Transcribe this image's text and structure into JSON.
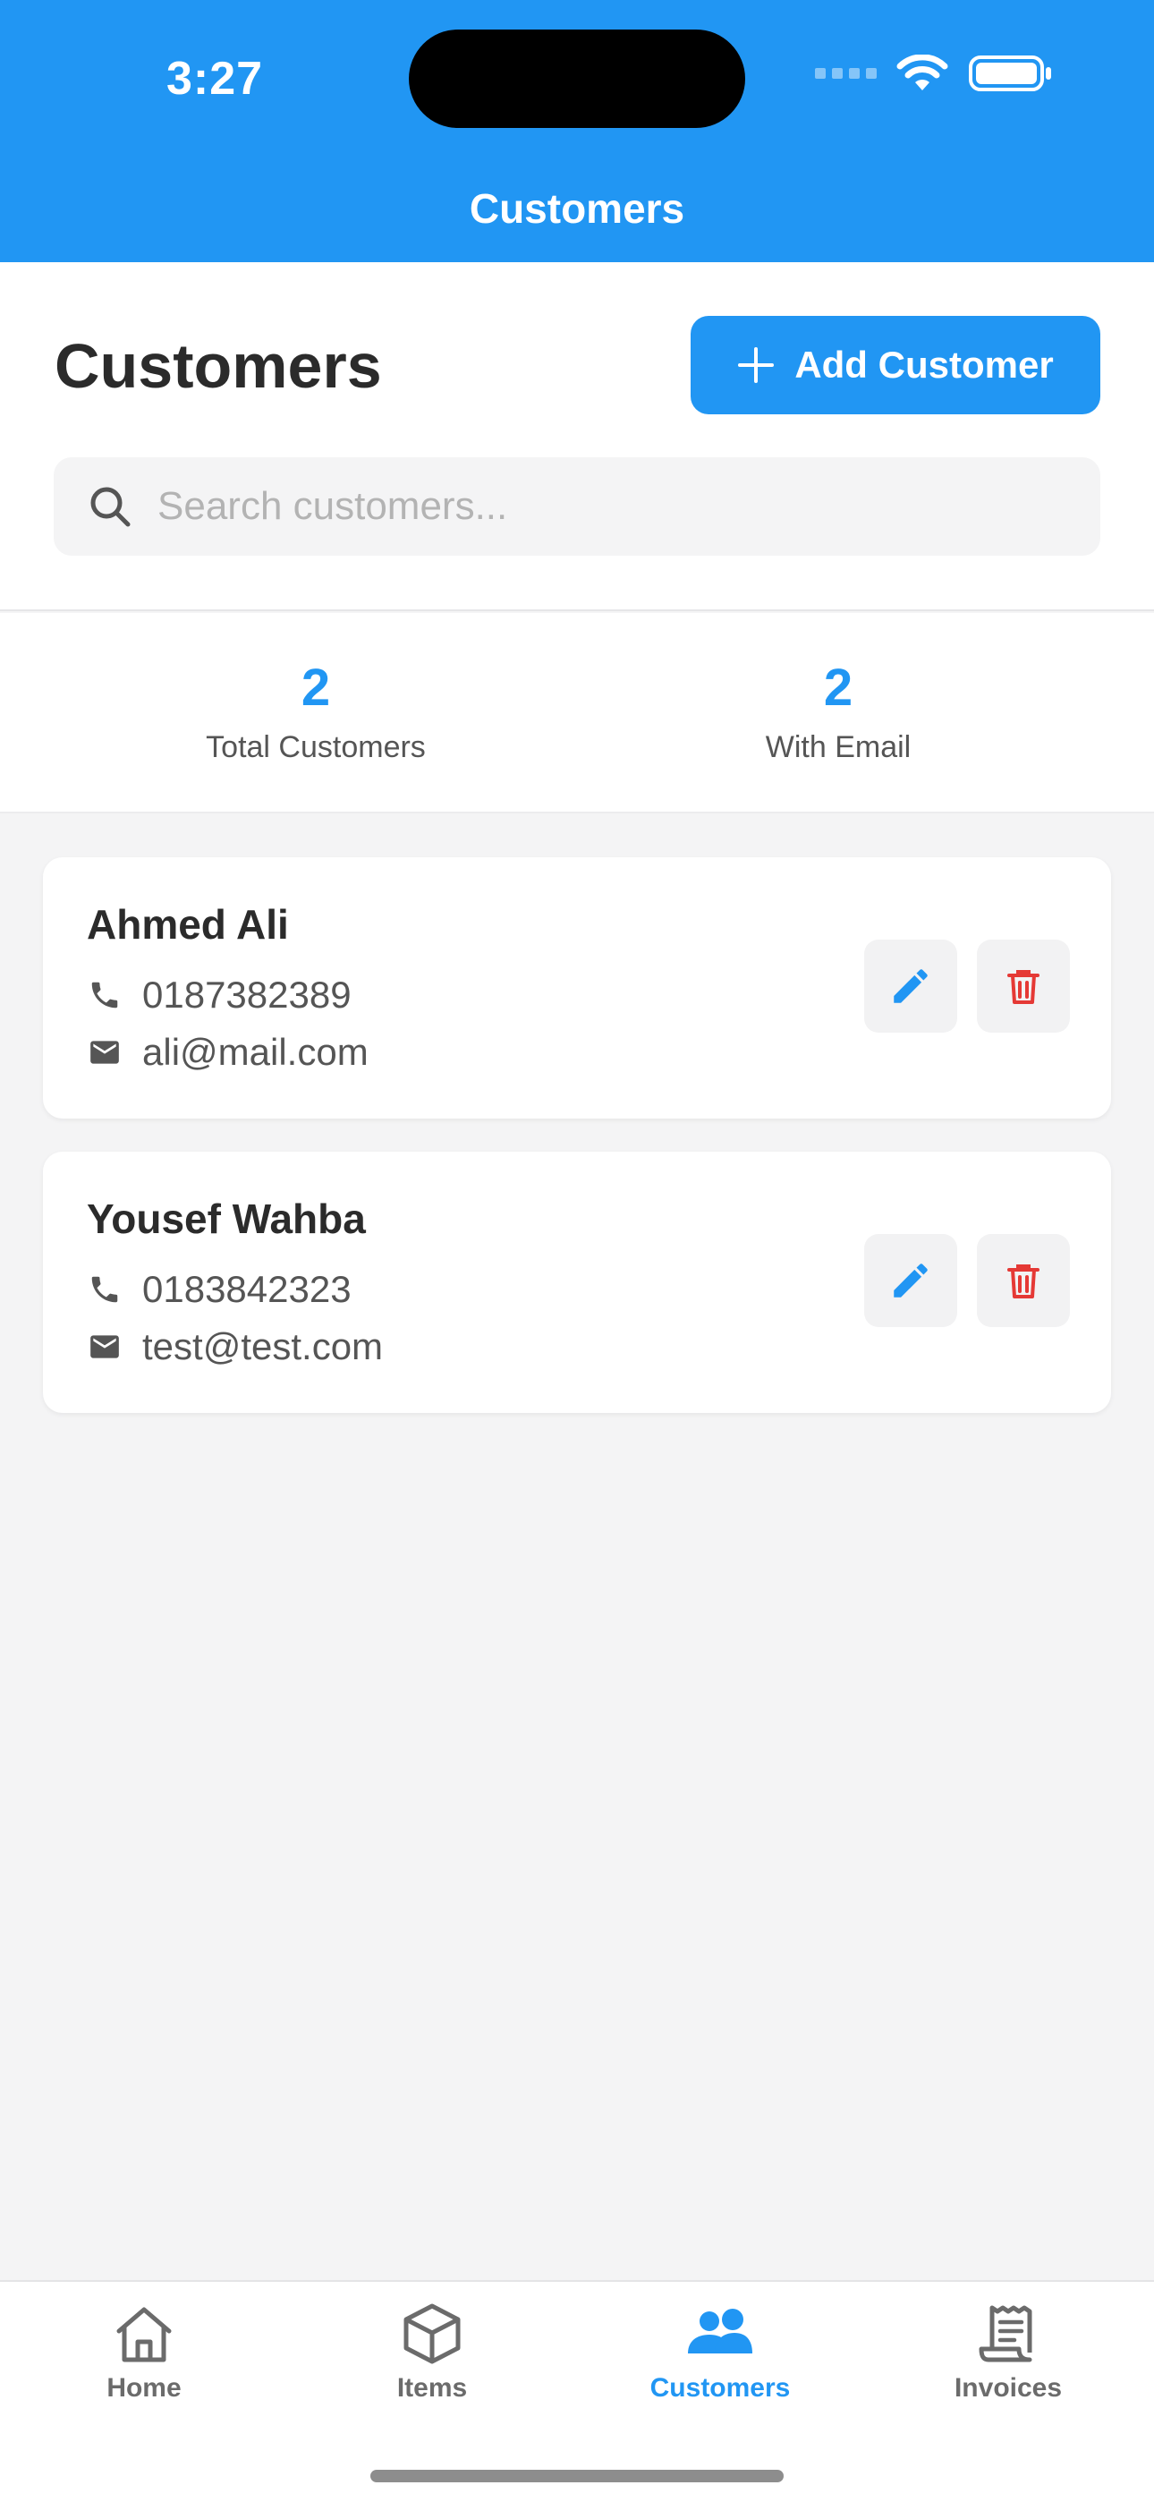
{
  "status_bar": {
    "time": "3:27"
  },
  "header": {
    "title": "Customers"
  },
  "page": {
    "title": "Customers",
    "add_button_label": "Add Customer"
  },
  "search": {
    "placeholder": "Search customers...",
    "value": ""
  },
  "stats": [
    {
      "value": "2",
      "label": "Total Customers"
    },
    {
      "value": "2",
      "label": "With Email"
    }
  ],
  "customers": [
    {
      "name": "Ahmed Ali",
      "phone": "0187382389",
      "email": "ali@mail.com"
    },
    {
      "name": "Yousef Wahba",
      "phone": "0183842323",
      "email": "test@test.com"
    }
  ],
  "tabs": [
    {
      "label": "Home",
      "icon": "home-icon",
      "active": false
    },
    {
      "label": "Items",
      "icon": "cube-icon",
      "active": false
    },
    {
      "label": "Customers",
      "icon": "people-icon",
      "active": true
    },
    {
      "label": "Invoices",
      "icon": "receipt-icon",
      "active": false
    }
  ],
  "colors": {
    "accent": "#2196F3",
    "danger": "#E53935",
    "background": "#F4F4F5"
  }
}
